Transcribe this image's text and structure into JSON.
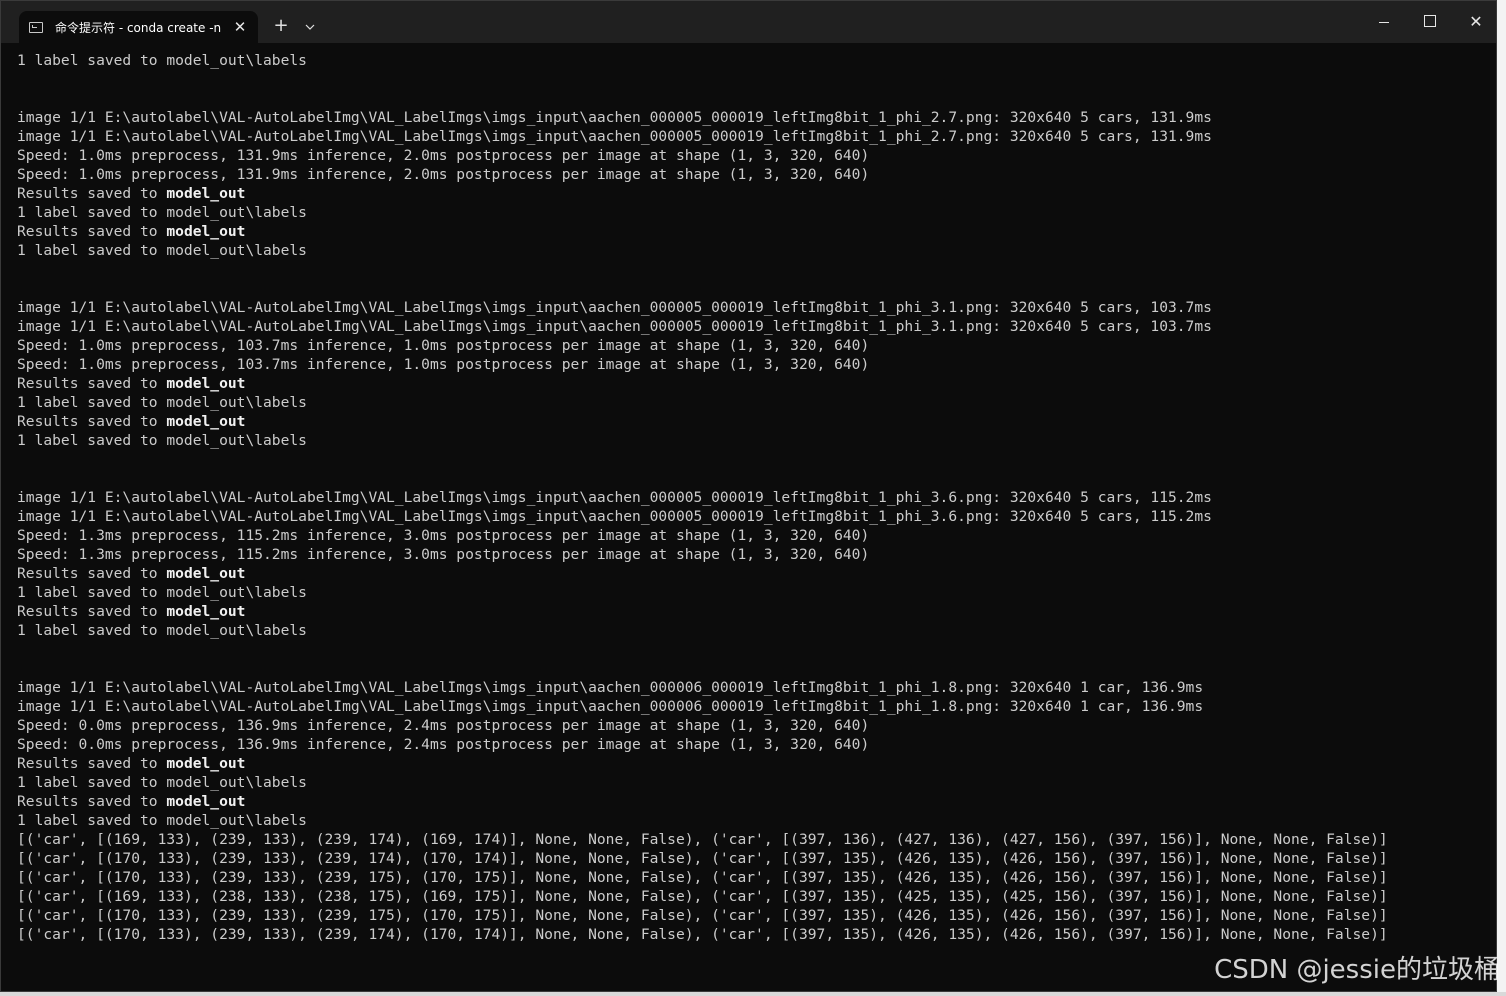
{
  "window": {
    "tab_title": "命令提示符 - conda  create -n",
    "tab_close": "✕",
    "new_tab": "+",
    "dropdown": "⌄",
    "minimize": "",
    "maximize": "",
    "close": "✕"
  },
  "console_lines": [
    {
      "pre": "1 label saved to model_out\\labels"
    },
    {
      "pre": ""
    },
    {
      "pre": ""
    },
    {
      "pre": "image 1/1 E:\\autolabel\\VAL-AutoLabelImg\\VAL_LabelImgs\\imgs_input\\aachen_000005_000019_leftImg8bit_1_phi_2.7.png: 320x640 5 cars, 131.9ms"
    },
    {
      "pre": "image 1/1 E:\\autolabel\\VAL-AutoLabelImg\\VAL_LabelImgs\\imgs_input\\aachen_000005_000019_leftImg8bit_1_phi_2.7.png: 320x640 5 cars, 131.9ms"
    },
    {
      "pre": "Speed: 1.0ms preprocess, 131.9ms inference, 2.0ms postprocess per image at shape (1, 3, 320, 640)"
    },
    {
      "pre": "Speed: 1.0ms preprocess, 131.9ms inference, 2.0ms postprocess per image at shape (1, 3, 320, 640)"
    },
    {
      "pre": "Results saved to ",
      "bold": "model_out"
    },
    {
      "pre": "1 label saved to model_out\\labels"
    },
    {
      "pre": "Results saved to ",
      "bold": "model_out"
    },
    {
      "pre": "1 label saved to model_out\\labels"
    },
    {
      "pre": ""
    },
    {
      "pre": ""
    },
    {
      "pre": "image 1/1 E:\\autolabel\\VAL-AutoLabelImg\\VAL_LabelImgs\\imgs_input\\aachen_000005_000019_leftImg8bit_1_phi_3.1.png: 320x640 5 cars, 103.7ms"
    },
    {
      "pre": "image 1/1 E:\\autolabel\\VAL-AutoLabelImg\\VAL_LabelImgs\\imgs_input\\aachen_000005_000019_leftImg8bit_1_phi_3.1.png: 320x640 5 cars, 103.7ms"
    },
    {
      "pre": "Speed: 1.0ms preprocess, 103.7ms inference, 1.0ms postprocess per image at shape (1, 3, 320, 640)"
    },
    {
      "pre": "Speed: 1.0ms preprocess, 103.7ms inference, 1.0ms postprocess per image at shape (1, 3, 320, 640)"
    },
    {
      "pre": "Results saved to ",
      "bold": "model_out"
    },
    {
      "pre": "1 label saved to model_out\\labels"
    },
    {
      "pre": "Results saved to ",
      "bold": "model_out"
    },
    {
      "pre": "1 label saved to model_out\\labels"
    },
    {
      "pre": ""
    },
    {
      "pre": ""
    },
    {
      "pre": "image 1/1 E:\\autolabel\\VAL-AutoLabelImg\\VAL_LabelImgs\\imgs_input\\aachen_000005_000019_leftImg8bit_1_phi_3.6.png: 320x640 5 cars, 115.2ms"
    },
    {
      "pre": "image 1/1 E:\\autolabel\\VAL-AutoLabelImg\\VAL_LabelImgs\\imgs_input\\aachen_000005_000019_leftImg8bit_1_phi_3.6.png: 320x640 5 cars, 115.2ms"
    },
    {
      "pre": "Speed: 1.3ms preprocess, 115.2ms inference, 3.0ms postprocess per image at shape (1, 3, 320, 640)"
    },
    {
      "pre": "Speed: 1.3ms preprocess, 115.2ms inference, 3.0ms postprocess per image at shape (1, 3, 320, 640)"
    },
    {
      "pre": "Results saved to ",
      "bold": "model_out"
    },
    {
      "pre": "1 label saved to model_out\\labels"
    },
    {
      "pre": "Results saved to ",
      "bold": "model_out"
    },
    {
      "pre": "1 label saved to model_out\\labels"
    },
    {
      "pre": ""
    },
    {
      "pre": ""
    },
    {
      "pre": "image 1/1 E:\\autolabel\\VAL-AutoLabelImg\\VAL_LabelImgs\\imgs_input\\aachen_000006_000019_leftImg8bit_1_phi_1.8.png: 320x640 1 car, 136.9ms"
    },
    {
      "pre": "image 1/1 E:\\autolabel\\VAL-AutoLabelImg\\VAL_LabelImgs\\imgs_input\\aachen_000006_000019_leftImg8bit_1_phi_1.8.png: 320x640 1 car, 136.9ms"
    },
    {
      "pre": "Speed: 0.0ms preprocess, 136.9ms inference, 2.4ms postprocess per image at shape (1, 3, 320, 640)"
    },
    {
      "pre": "Speed: 0.0ms preprocess, 136.9ms inference, 2.4ms postprocess per image at shape (1, 3, 320, 640)"
    },
    {
      "pre": "Results saved to ",
      "bold": "model_out"
    },
    {
      "pre": "1 label saved to model_out\\labels"
    },
    {
      "pre": "Results saved to ",
      "bold": "model_out"
    },
    {
      "pre": "1 label saved to model_out\\labels"
    },
    {
      "pre": "[('car', [(169, 133), (239, 133), (239, 174), (169, 174)], None, None, False), ('car', [(397, 136), (427, 136), (427, 156), (397, 156)], None, None, False)]"
    },
    {
      "pre": "[('car', [(170, 133), (239, 133), (239, 174), (170, 174)], None, None, False), ('car', [(397, 135), (426, 135), (426, 156), (397, 156)], None, None, False)]"
    },
    {
      "pre": "[('car', [(170, 133), (239, 133), (239, 175), (170, 175)], None, None, False), ('car', [(397, 135), (426, 135), (426, 156), (397, 156)], None, None, False)]"
    },
    {
      "pre": "[('car', [(169, 133), (238, 133), (238, 175), (169, 175)], None, None, False), ('car', [(397, 135), (425, 135), (425, 156), (397, 156)], None, None, False)]"
    },
    {
      "pre": "[('car', [(170, 133), (239, 133), (239, 175), (170, 175)], None, None, False), ('car', [(397, 135), (426, 135), (426, 156), (397, 156)], None, None, False)]"
    },
    {
      "pre": "[('car', [(170, 133), (239, 133), (239, 174), (170, 174)], None, None, False), ('car', [(397, 135), (426, 135), (426, 156), (397, 156)], None, None, False)]"
    }
  ],
  "watermark": "CSDN @jessie的垃圾桶"
}
